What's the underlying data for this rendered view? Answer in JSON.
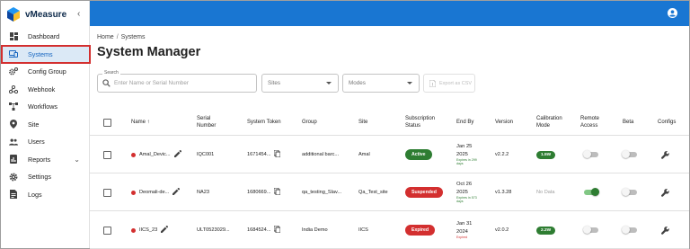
{
  "app": {
    "name": "vMeasure",
    "collapse_icon": "chevron-left-icon"
  },
  "sidebar": {
    "items": [
      {
        "label": "Dashboard",
        "icon": "dashboard-icon"
      },
      {
        "label": "Systems",
        "icon": "devices-icon",
        "active": true
      },
      {
        "label": "Config Group",
        "icon": "settings-group-icon"
      },
      {
        "label": "Webhook",
        "icon": "webhook-icon"
      },
      {
        "label": "Workflows",
        "icon": "workflow-icon"
      },
      {
        "label": "Site",
        "icon": "location-pin-icon"
      },
      {
        "label": "Users",
        "icon": "users-icon"
      },
      {
        "label": "Reports",
        "icon": "report-icon",
        "expandable": true
      },
      {
        "label": "Settings",
        "icon": "gear-icon"
      },
      {
        "label": "Logs",
        "icon": "log-file-icon"
      }
    ]
  },
  "topbar": {
    "account_icon": "account-circle-icon",
    "color": "#1976d2"
  },
  "breadcrumb": {
    "home": "Home",
    "separator": "/",
    "current": "Systems"
  },
  "page": {
    "title": "System Manager"
  },
  "filters": {
    "search": {
      "legend": "Search",
      "placeholder": "Enter Name or Serial Number"
    },
    "sites": {
      "placeholder": "Sites"
    },
    "modes": {
      "placeholder": "Modes"
    },
    "export_label": "Export as CSV"
  },
  "table": {
    "headers": {
      "name": "Name ↑",
      "serial_line1": "Serial",
      "serial_line2": "Number",
      "token": "System Token",
      "group": "Group",
      "site": "Site",
      "subscription_line1": "Subscription",
      "subscription_line2": "Status",
      "end_by": "End By",
      "version": "Version",
      "calibration_line1": "Calibration",
      "calibration_line2": "Mode",
      "remote_line1": "Remote",
      "remote_line2": "Access",
      "beta": "Beta",
      "configs": "Configs"
    },
    "rows": [
      {
        "name": "Amal_Devic...",
        "serial": "IQC001",
        "token": "1671454...",
        "group": "additional barc...",
        "site": "Amal",
        "status": "Active",
        "status_color": "#2e7d32",
        "end_date_l1": "Jan 25",
        "end_date_l2": "2025",
        "end_note_l1": "Expires in 299",
        "end_note_l2": "days",
        "version": "v2.2.2",
        "calibration": "1.5W",
        "remote_access": false,
        "beta": false
      },
      {
        "name": "Deomali-de...",
        "serial": "NA23",
        "token": "1680669...",
        "group": "qa_testing_Slav...",
        "site": "Qa_Test_site",
        "status": "Suspended",
        "status_color": "#d32f2f",
        "end_date_l1": "Oct 26",
        "end_date_l2": "2025",
        "end_note_l1": "Expires in 573",
        "end_note_l2": "days",
        "version": "v1.3.28",
        "calibration": "No Data",
        "remote_access": true,
        "beta": false
      },
      {
        "name": "IICS_23",
        "serial": "ULT0523029...",
        "token": "1684524...",
        "group": "India Demo",
        "site": "IICS",
        "status": "Expired",
        "status_color": "#d32f2f",
        "end_date_l1": "Jan 31",
        "end_date_l2": "2024",
        "end_note_l1": "Expired",
        "end_note_l2": "",
        "version": "v2.0.2",
        "calibration": "2.2W",
        "remote_access": false,
        "beta": false
      }
    ]
  }
}
